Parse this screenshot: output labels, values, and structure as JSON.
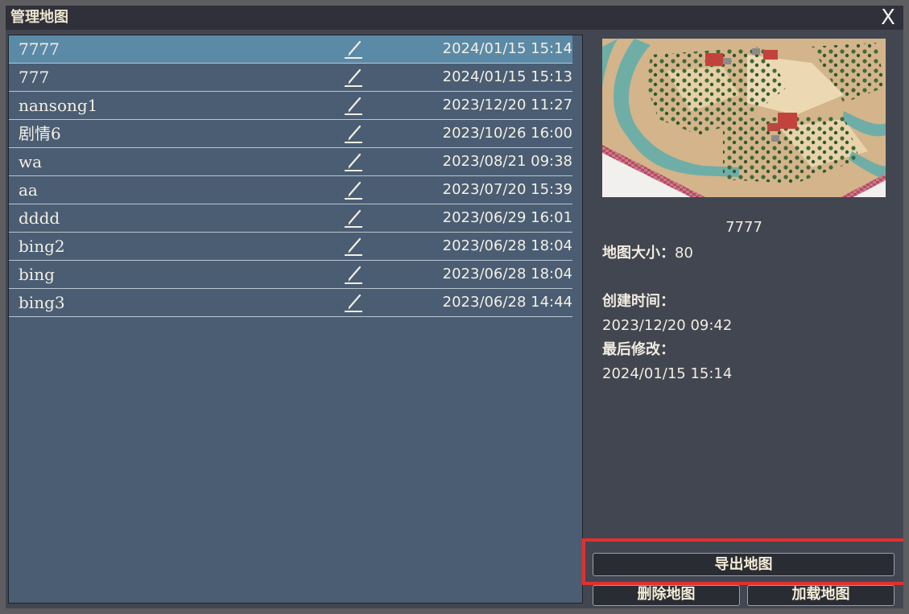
{
  "window": {
    "title": "管理地图",
    "close_label": "X"
  },
  "maps": [
    {
      "name": "7777",
      "date": "2024/01/15 15:14",
      "selected": true
    },
    {
      "name": "777",
      "date": "2024/01/15 15:13",
      "selected": false
    },
    {
      "name": "nansong1",
      "date": "2023/12/20 11:27",
      "selected": false
    },
    {
      "name": "剧情6",
      "date": "2023/10/26 16:00",
      "selected": false
    },
    {
      "name": "wa",
      "date": "2023/08/21 09:38",
      "selected": false
    },
    {
      "name": "aa",
      "date": "2023/07/20 15:39",
      "selected": false
    },
    {
      "name": "dddd",
      "date": "2023/06/29 16:01",
      "selected": false
    },
    {
      "name": "bing2",
      "date": "2023/06/28 18:04",
      "selected": false
    },
    {
      "name": "bing",
      "date": "2023/06/28 18:04",
      "selected": false
    },
    {
      "name": "bing3",
      "date": "2023/06/28 14:44",
      "selected": false
    }
  ],
  "details": {
    "name": "7777",
    "size_label": "地图大小：",
    "size_value": "80",
    "created_label": "创建时间：",
    "created_value": "2023/12/20 09:42",
    "modified_label": "最后修改：",
    "modified_value": "2024/01/15 15:14"
  },
  "buttons": {
    "export": "导出地图",
    "delete": "删除地图",
    "load": "加载地图"
  },
  "icons": {
    "edit": "pencil-edit-icon",
    "close": "close-icon"
  },
  "colors": {
    "window_bg": "#424651",
    "list_bg": "#4a5d73",
    "selected_row": "#5b8aa6",
    "highlight": "#e0312f"
  }
}
